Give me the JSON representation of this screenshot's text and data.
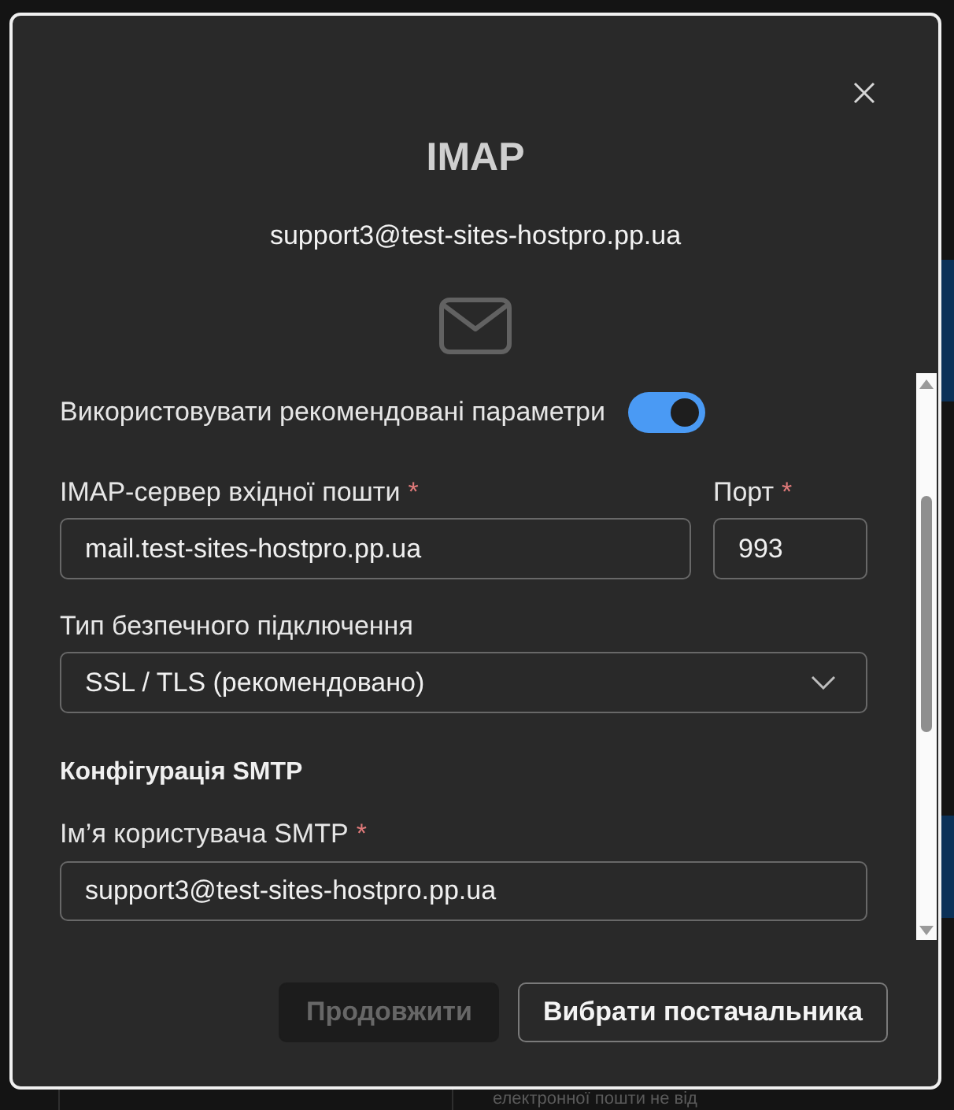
{
  "dialog": {
    "title": "IMAP",
    "subtitle": "support3@test-sites-hostpro.pp.ua"
  },
  "form_items": [
    {
      "kind": "toggle",
      "label": "Використовувати рекомендовані параметри",
      "on": true
    },
    {
      "kind": "field_row",
      "fields": [
        {
          "label": "IMAP-сервер вхідної пошти",
          "required_mark": "*",
          "value": "mail.test-sites-hostpro.pp.ua"
        },
        {
          "label": "Порт",
          "required_mark": "*",
          "value": "993"
        }
      ]
    },
    {
      "kind": "select",
      "label": "Тип безпечного підключення",
      "value": "SSL / TLS (рекомендовано)"
    },
    {
      "kind": "heading",
      "text": "Конфігурація SMTP"
    },
    {
      "kind": "field_row",
      "fields": [
        {
          "label": "Ім’я користувача SMTP",
          "required_mark": "*",
          "value": "support3@test-sites-hostpro.pp.ua"
        }
      ]
    }
  ],
  "buttons": [
    {
      "label": "Продовжити",
      "disabled": true
    },
    {
      "label": "Вибрати постачальника",
      "disabled": false
    }
  ],
  "background": {
    "text": "електронної пошти не від"
  }
}
